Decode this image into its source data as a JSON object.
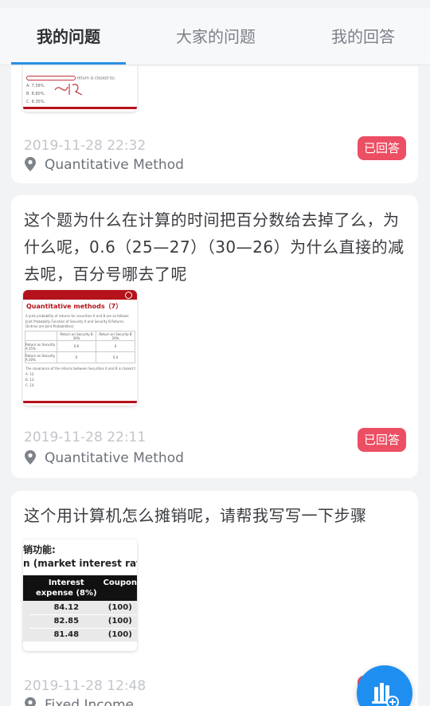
{
  "tabs": [
    "我的问题",
    "大家的问题",
    "我的回答"
  ],
  "cards": [
    {
      "time": "2019-11-28 22:32",
      "tag": "Quantitative Method",
      "status": "已回答"
    },
    {
      "question": "这个题为什么在计算的时间把百分数给去掉了么，为什么呢，0.6（25—27）（30—26）为什么直接的减去呢，百分号哪去了呢",
      "time": "2019-11-28 22:11",
      "tag": "Quantitative Method",
      "status": "已回答",
      "thumb": {
        "title": "Quantitative methods（7）",
        "line1": "A joint probability of returns for securities A and B are as follows:",
        "line2": "Joint Probability Function of Security A and Security B Returns (Entries are Joint Probabilities)",
        "col1": "Return on Security B 30%",
        "col2": "Return on Security B 20%",
        "row1": "Return on Security A 25%",
        "row1v1": "0.6",
        "row1v2": "0",
        "row2": "Return on Security A 20%",
        "row2v1": "0",
        "row2v2": "0.4",
        "question": "The covariance of the returns between Securities A and B is closest to:",
        "opts": [
          "A. 12.",
          "B. 13.",
          "C. 14."
        ]
      }
    },
    {
      "question": "这个用计算机怎么摊销呢，请帮我写写一下步骤",
      "time": "2019-11-28 12:48",
      "tag": "Fixed Income",
      "thumb": {
        "line1": "销功能:",
        "line2": "n (market interest rate at",
        "head1": "Interest expense (8%)",
        "head2": "Coupon",
        "rows": [
          [
            "84.12",
            "(100)"
          ],
          [
            "82.85",
            "(100)"
          ],
          [
            "81.48",
            "(100)"
          ]
        ]
      }
    }
  ],
  "thumb0": {
    "line1": "return is closest to:",
    "opts": [
      "A. 7.38%.",
      "B. 8.80%.",
      "C. 8.35%."
    ]
  }
}
